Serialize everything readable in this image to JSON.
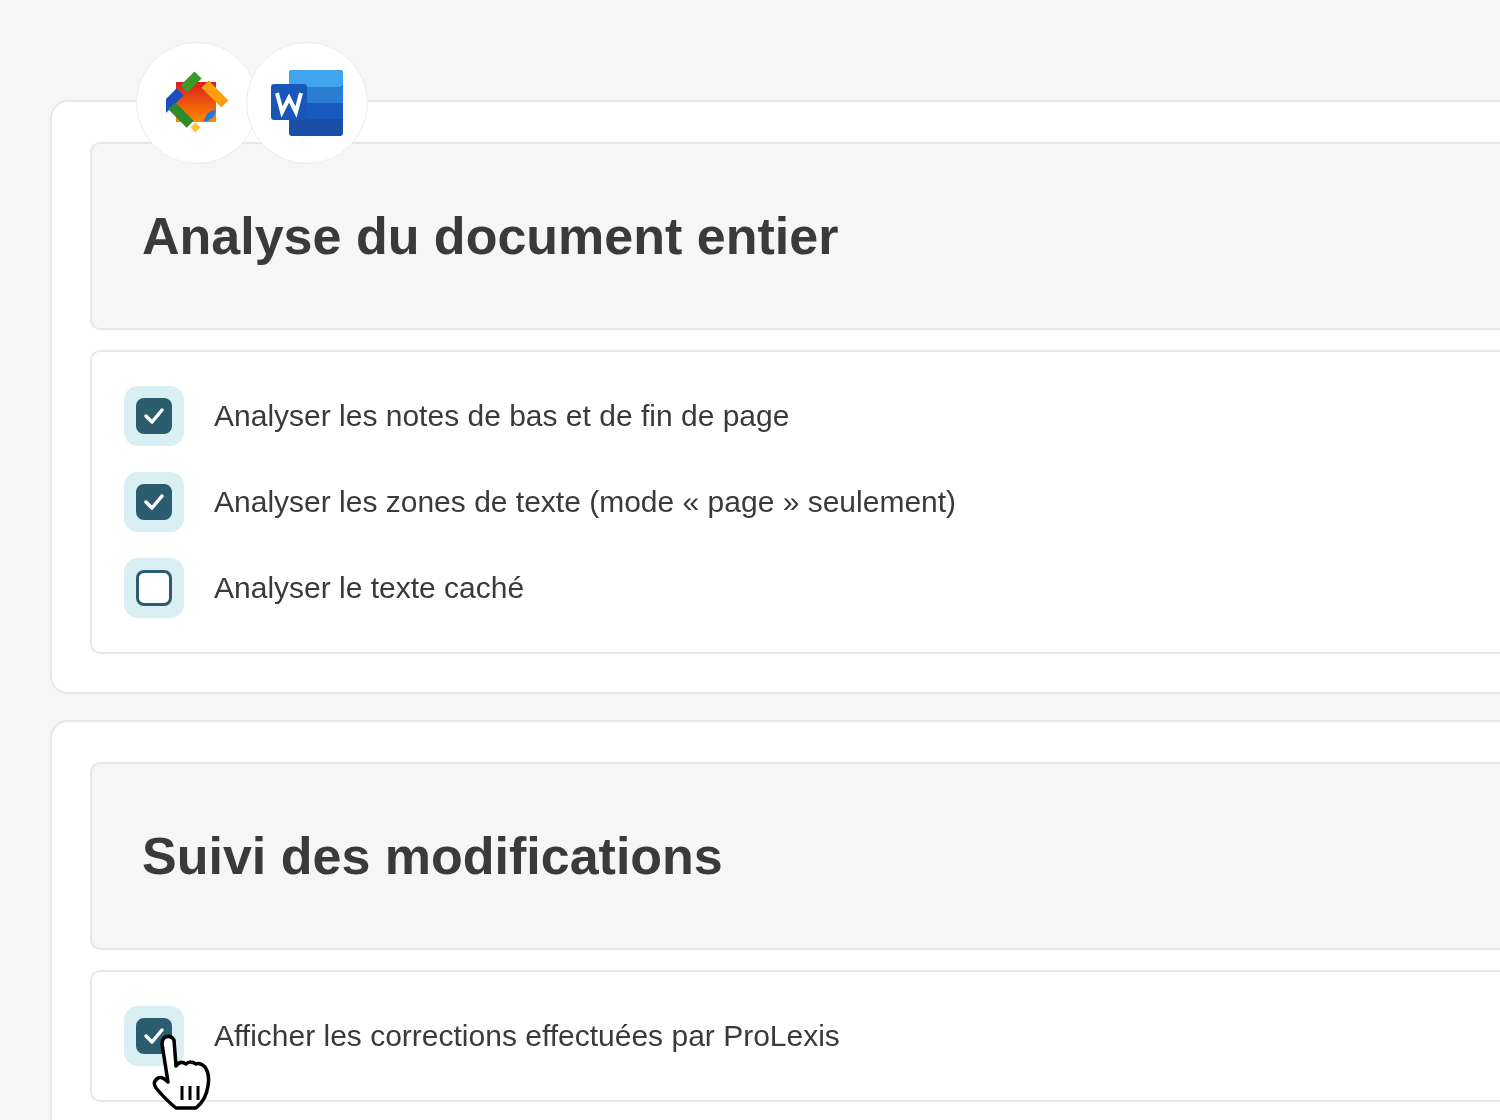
{
  "sections": [
    {
      "title": "Analyse du document entier",
      "options": [
        {
          "label": "Analyser les notes de bas et de fin de page",
          "checked": true
        },
        {
          "label": "Analyser les zones de texte (mode « page » seulement)",
          "checked": true
        },
        {
          "label": "Analyser le texte caché",
          "checked": false
        }
      ]
    },
    {
      "title": "Suivi des modifications",
      "options": [
        {
          "label": "Afficher les corrections effectuées par ProLexis",
          "checked": true
        }
      ]
    }
  ]
}
